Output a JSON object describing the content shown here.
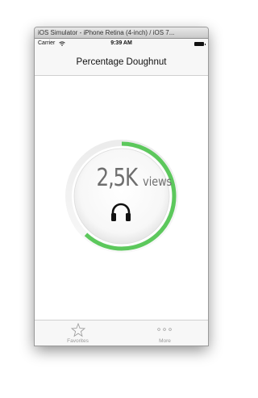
{
  "window": {
    "title": "iOS Simulator - iPhone Retina (4-inch) / iOS 7..."
  },
  "statusbar": {
    "carrier": "Carrier",
    "time": "9:39 AM"
  },
  "navbar": {
    "title": "Percentage Doughnut"
  },
  "doughnut": {
    "value_number": "2,5K",
    "value_unit": "views",
    "percent": 0.62,
    "accent_color": "#5cc85c",
    "icon": "headphones-icon"
  },
  "tabbar": {
    "items": [
      {
        "label": "Favorites",
        "icon": "star-icon"
      },
      {
        "label": "More",
        "icon": "more-dots-icon"
      }
    ]
  }
}
